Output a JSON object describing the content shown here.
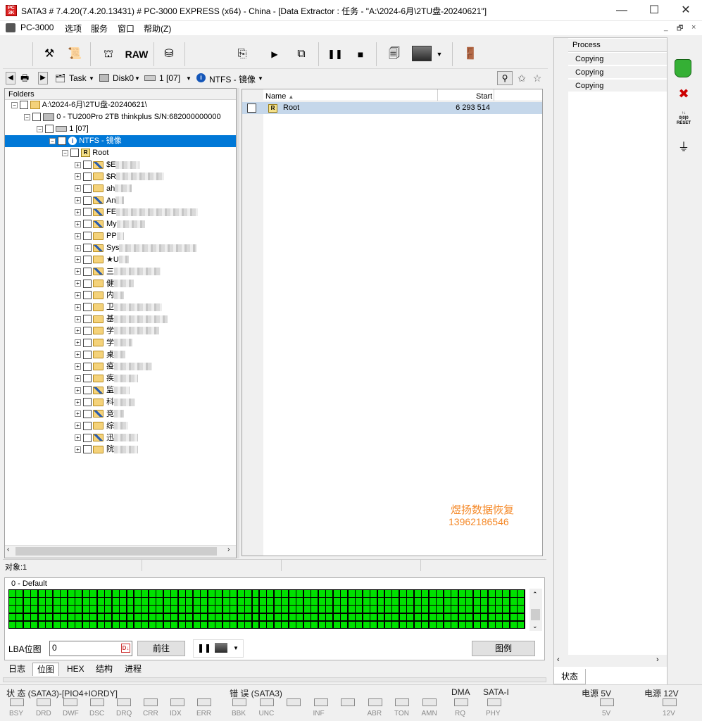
{
  "titlebar": {
    "title": "SATA3 # 7.4.20(7.4.20.13431) # PC-3000 EXPRESS (x64) - China - [Data Extractor : 任务 - \"A:\\2024-6月\\2TU盘-20240621\"]",
    "minimize": "—",
    "maximize": "☐",
    "close": "✕"
  },
  "menu": {
    "app": "PC-3000",
    "items": [
      "选项",
      "服务",
      "窗口",
      "帮助(Z)"
    ],
    "mdi_controls": [
      "_",
      "🗗",
      "×"
    ]
  },
  "toolbar": {
    "raw_label": "RAW"
  },
  "navbar": {
    "task": "Task",
    "disk": "Disk0",
    "partition": "1 [07]",
    "fs": "NTFS - 镜像"
  },
  "folders": {
    "header": "Folders",
    "root_path": "A:\\2024-6月\\2TU盘-20240621\\",
    "disk": "0 - TU200Pro 2TB thinkplus  S/N:682000000000",
    "partition": "1 [07]",
    "fs": "NTFS - 镜像",
    "root": "Root",
    "items": [
      {
        "label": "$E",
        "special": true
      },
      {
        "label": "$R",
        "special": false
      },
      {
        "label": "ah",
        "special": false
      },
      {
        "label": "An",
        "special": true
      },
      {
        "label": "FE",
        "special": true
      },
      {
        "label": "My",
        "special": true
      },
      {
        "label": "PP",
        "special": false
      },
      {
        "label": "Sys",
        "special": true
      },
      {
        "label": "★U",
        "special": false
      },
      {
        "label": "三",
        "special": true
      },
      {
        "label": "健",
        "special": false
      },
      {
        "label": "内",
        "special": false
      },
      {
        "label": "卫",
        "special": false
      },
      {
        "label": "基",
        "special": false
      },
      {
        "label": "学",
        "special": false
      },
      {
        "label": "学",
        "special": false
      },
      {
        "label": "桌",
        "special": false
      },
      {
        "label": "疫",
        "special": false
      },
      {
        "label": "疾",
        "special": false
      },
      {
        "label": "监",
        "special": true
      },
      {
        "label": "科",
        "special": false
      },
      {
        "label": "竞",
        "special": true
      },
      {
        "label": "综",
        "special": false
      },
      {
        "label": "迅",
        "special": true
      },
      {
        "label": "院",
        "special": false
      }
    ]
  },
  "list": {
    "col_name": "Name",
    "col_start": "Start",
    "rows": [
      {
        "name": "Root",
        "start": "6 293 514"
      }
    ]
  },
  "watermark": {
    "line1": "煜扬数据恢复",
    "line2": "13962186546"
  },
  "status": {
    "objects": "对象:1"
  },
  "bitmap": {
    "title": "0 - Default",
    "lba_label": "LBA位图",
    "lba_value": "0",
    "goto_button": "前往",
    "legend_button": "图例",
    "fill_color": "#00e000"
  },
  "tabs": [
    "日志",
    "位图",
    "HEX",
    "结构",
    "进程"
  ],
  "process": {
    "header": "Process",
    "rows": [
      "Copying",
      "Copying",
      "Copying"
    ],
    "tab": "状态"
  },
  "bottom": {
    "status_title": "状 态 (SATA3)-[PIO4+IORDY]",
    "error_title": "错 误 (SATA3)",
    "dma_title": "DMA",
    "satai_title": "SATA-I",
    "power5": "电源 5V",
    "power12": "电源 12V",
    "status_leds": [
      "BSY",
      "DRD",
      "DWF",
      "DSC",
      "DRQ",
      "CRR",
      "IDX",
      "ERR"
    ],
    "error_leds": [
      "BBK",
      "UNC",
      "",
      "INF",
      "",
      "ABR",
      "TON",
      "AMN"
    ],
    "dma_led": "RQ",
    "satai_led": "PHY",
    "p5_led": "5V",
    "p12_led": "12V"
  }
}
